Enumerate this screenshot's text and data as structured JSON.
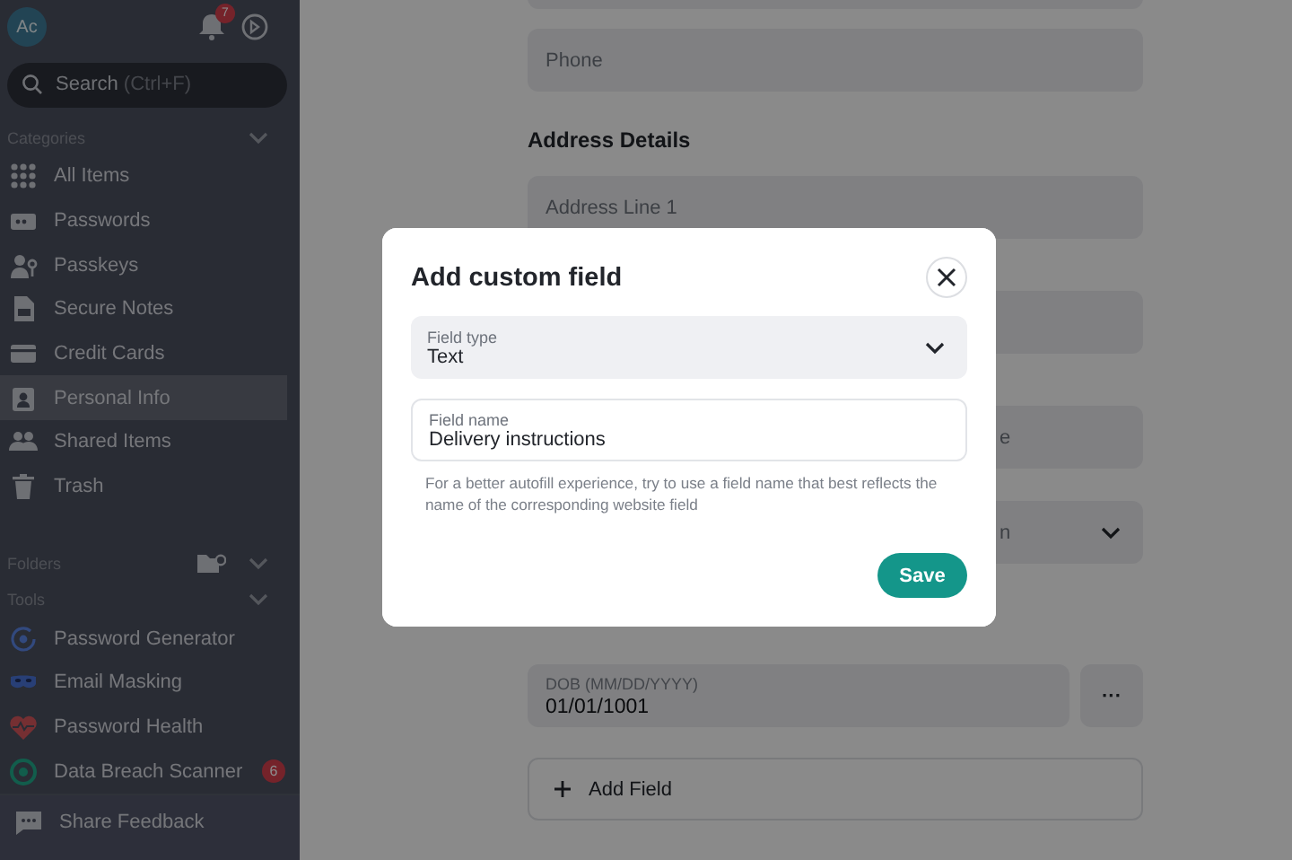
{
  "sidebar": {
    "avatar": "Ac",
    "notification_count": "7",
    "search": {
      "placeholder": "Search",
      "shortcut": "(Ctrl+F)"
    },
    "categories": {
      "title": "Categories",
      "items": [
        {
          "label": "All Items",
          "selected": false
        },
        {
          "label": "Passwords",
          "selected": false
        },
        {
          "label": "Passkeys",
          "selected": false
        },
        {
          "label": "Secure Notes",
          "selected": false
        },
        {
          "label": "Credit Cards",
          "selected": false
        },
        {
          "label": "Personal Info",
          "selected": true
        },
        {
          "label": "Shared Items",
          "selected": false
        },
        {
          "label": "Trash",
          "selected": false
        }
      ]
    },
    "folders": {
      "title": "Folders"
    },
    "tools": {
      "title": "Tools",
      "items": [
        {
          "label": "Password Generator"
        },
        {
          "label": "Email Masking"
        },
        {
          "label": "Password Health"
        },
        {
          "label": "Data Breach Scanner",
          "badge": "6"
        }
      ]
    },
    "footer": {
      "label": "Share Feedback"
    }
  },
  "main": {
    "items": [
      {
        "kind": "field"
      },
      {
        "kind": "field",
        "placeholder": "Phone"
      },
      {
        "kind": "heading",
        "text": "Address Details"
      },
      {
        "kind": "field",
        "placeholder": "Address Line 1"
      },
      {
        "kind": "field"
      },
      {
        "kind": "covered",
        "placeholder": "e"
      },
      {
        "kind": "covered_select",
        "placeholder": "n"
      },
      {
        "kind": "date",
        "label": "DOB (MM/DD/YYYY)",
        "value": "01/01/1001",
        "more": "···"
      },
      {
        "kind": "add",
        "label": "Add Field"
      }
    ]
  },
  "modal": {
    "title": "Add custom field",
    "field_type": {
      "label": "Field type",
      "value": "Text"
    },
    "field_name": {
      "label": "Field name",
      "value": "Delivery instructions"
    },
    "hint": "For a better autofill experience, try to use a field name that best reflects the name of the corresponding website field",
    "save": "Save"
  }
}
